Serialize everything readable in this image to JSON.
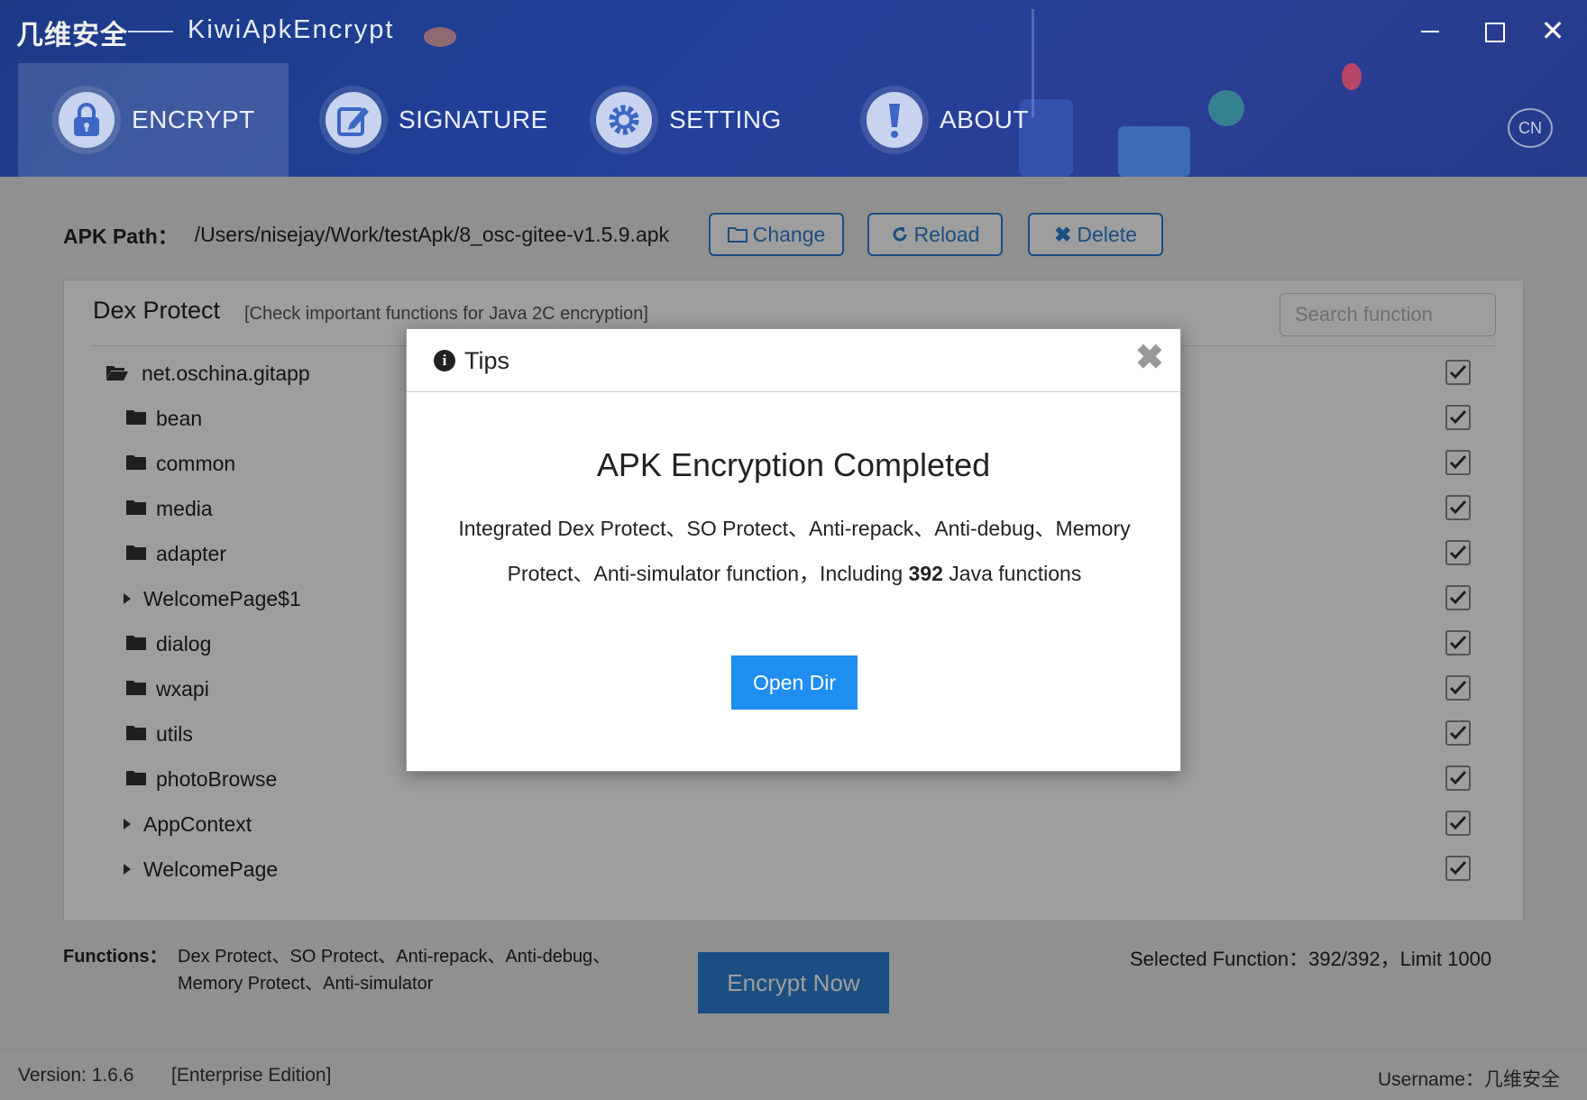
{
  "window": {
    "brand": "几维安全",
    "title": "KiwiApkEncrypt",
    "minimize_icon": "minimize-icon",
    "maximize_icon": "maximize-icon",
    "close_icon": "close-icon"
  },
  "nav": {
    "tabs": [
      {
        "label": "ENCRYPT",
        "icon": "lock-icon",
        "active": true
      },
      {
        "label": "SIGNATURE",
        "icon": "edit-icon",
        "active": false
      },
      {
        "label": "SETTING",
        "icon": "gear-icon",
        "active": false
      },
      {
        "label": "ABOUT",
        "icon": "exclamation-icon",
        "active": false
      }
    ],
    "lang": "CN"
  },
  "apk": {
    "label": "APK Path：",
    "path": "/Users/nisejay/Work/testApk/8_osc-gitee-v1.5.9.apk",
    "change": "Change",
    "reload": "Reload",
    "delete": "Delete"
  },
  "panel": {
    "title": "Dex Protect",
    "subtitle": "[Check important functions for Java 2C encryption]",
    "search_placeholder": "Search function",
    "tree": [
      {
        "label": "net.oschina.gitapp",
        "type": "folder-open",
        "checked": true
      },
      {
        "label": "bean",
        "type": "folder",
        "checked": true
      },
      {
        "label": "common",
        "type": "folder",
        "checked": true
      },
      {
        "label": "media",
        "type": "folder",
        "checked": true
      },
      {
        "label": "adapter",
        "type": "folder",
        "checked": true
      },
      {
        "label": "WelcomePage$1",
        "type": "class",
        "checked": true
      },
      {
        "label": "dialog",
        "type": "folder",
        "checked": true
      },
      {
        "label": "wxapi",
        "type": "folder",
        "checked": true
      },
      {
        "label": "utils",
        "type": "folder",
        "checked": true
      },
      {
        "label": "photoBrowse",
        "type": "folder",
        "checked": true
      },
      {
        "label": "AppContext",
        "type": "class",
        "checked": true
      },
      {
        "label": "WelcomePage",
        "type": "class",
        "checked": true
      }
    ]
  },
  "footer": {
    "functions_label": "Functions：",
    "functions_line1": "Dex Protect、SO Protect、Anti-repack、Anti-debug、",
    "functions_line2": "Memory Protect、Anti-simulator",
    "encrypt_button": "Encrypt Now",
    "selected": "Selected Function：392/392，Limit 1000"
  },
  "status": {
    "version": "Version: 1.6.6",
    "edition": "[Enterprise Edition]",
    "username": "Username：几维安全"
  },
  "modal": {
    "title": "Tips",
    "heading": "APK Encryption Completed",
    "body_pre": "Integrated Dex Protect、SO Protect、Anti-repack、Anti-debug、Memory Protect、Anti-simulator function，Including ",
    "body_count": "392",
    "body_post": " Java functions",
    "button": "Open Dir"
  },
  "colors": {
    "header": "#22409a",
    "accent": "#2c7fd2",
    "modal_button": "#1e8ef0"
  }
}
